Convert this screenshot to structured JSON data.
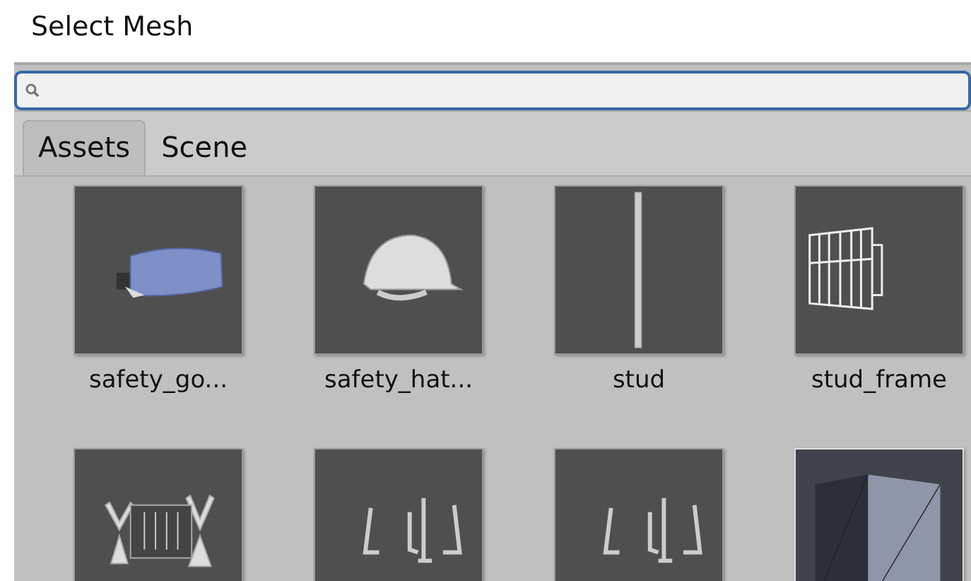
{
  "window": {
    "title": "Select Mesh"
  },
  "tabs": [
    {
      "label": "Assets",
      "selected": true
    },
    {
      "label": "Scene",
      "selected": false
    }
  ],
  "items": [
    {
      "kind": "goggles",
      "label": "safety_go..."
    },
    {
      "kind": "helmet",
      "label": "safety_hat..."
    },
    {
      "kind": "stud",
      "label": "stud"
    },
    {
      "kind": "frame",
      "label": "stud_frame"
    },
    {
      "kind": "sawhorses"
    },
    {
      "kind": "posts"
    },
    {
      "kind": "posts"
    },
    {
      "kind": "cube"
    }
  ]
}
